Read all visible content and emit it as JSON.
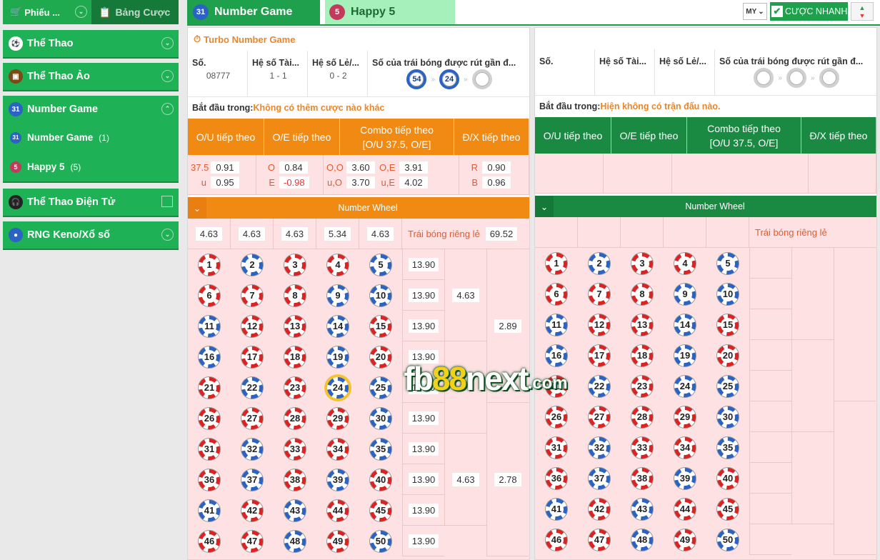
{
  "sidebar": {
    "tab_betslip": "Phiếu ...",
    "tab_board": "Bảng Cược",
    "menus": [
      {
        "label": "Thể Thao",
        "icon": "soccer-ball-icon"
      },
      {
        "label": "Thể Thao Ảo",
        "icon": "virtual-sports-icon"
      },
      {
        "label": "Number Game",
        "icon": "number-game-icon"
      },
      {
        "label": "Thể Thao Điện Tử",
        "icon": "headset-icon"
      },
      {
        "label": "RNG Keno/Xổ số",
        "icon": "keno-ball-icon"
      }
    ],
    "sub": [
      {
        "label": "Number Game",
        "count": "(1)"
      },
      {
        "label": "Happy 5",
        "count": "(5)"
      }
    ]
  },
  "header": {
    "tab1": "Number Game",
    "tab2": "Happy 5",
    "lang": "MY",
    "quick_bet": "CƯỢC NHANH"
  },
  "panelA": {
    "title": "Turbo Number Game",
    "cols": [
      "Số.",
      "Hệ số Tài...",
      "Hệ số Lẻ/...",
      "Số của trái bóng được rút gần đ..."
    ],
    "vals": [
      "08777",
      "1 - 1",
      "0 - 2"
    ],
    "drawn": [
      "54",
      "24",
      ""
    ],
    "start_label": "Bắt đầu trong:",
    "start_value": "Không có thêm cược nào khác",
    "heads": [
      "O/U tiếp theo",
      "O/E tiếp theo",
      "Combo tiếp theo\n[O/U 37.5, O/E]",
      "Đ/X tiếp theo"
    ],
    "ou": [
      [
        "37.5",
        "0.91"
      ],
      [
        "u",
        "0.95"
      ]
    ],
    "oe": [
      [
        "O",
        "0.84"
      ],
      [
        "E",
        "-0.98"
      ]
    ],
    "combo": [
      [
        "O,O",
        "3.60",
        "O,E",
        "3.91"
      ],
      [
        "u,O",
        "3.70",
        "u,E",
        "4.02"
      ]
    ],
    "dx": [
      [
        "R",
        "0.90"
      ],
      [
        "B",
        "0.96"
      ]
    ],
    "wheel": "Number Wheel",
    "wheel_odds": [
      "4.63",
      "4.63",
      "4.63",
      "5.34",
      "4.63"
    ],
    "rieng_label": "Trái bóng riêng lẻ",
    "rieng_value": "69.52",
    "col13": [
      "13.90",
      "13.90",
      "13.90",
      "13.90",
      "13.90",
      "13.90",
      "13.90",
      "13.90",
      "13.90",
      "13.90"
    ],
    "col463": [
      "4.63",
      "4.63"
    ],
    "col289": [
      "2.89",
      "2.78"
    ]
  },
  "panelB": {
    "cols": [
      "Số.",
      "Hệ số Tài...",
      "Hệ số Lẻ/...",
      "Số của trái bóng được rút gần đ..."
    ],
    "start_label": "Bắt đầu trong:",
    "start_value": "Hiện không có trận đấu nào.",
    "heads": [
      "O/U tiếp theo",
      "O/E tiếp theo",
      "Combo tiếp theo\n[O/U 37.5, O/E]",
      "Đ/X tiếp theo"
    ],
    "wheel": "Number Wheel",
    "rieng_label": "Trái bóng riêng lẻ"
  },
  "watermark": {
    "a": "fb",
    "b": "88",
    "c": "next",
    "d": ".com"
  },
  "colors": {
    "green": "#1fa04c",
    "orange": "#f08a12",
    "pink": "#fde1e3",
    "darkgreen": "#168c41"
  }
}
